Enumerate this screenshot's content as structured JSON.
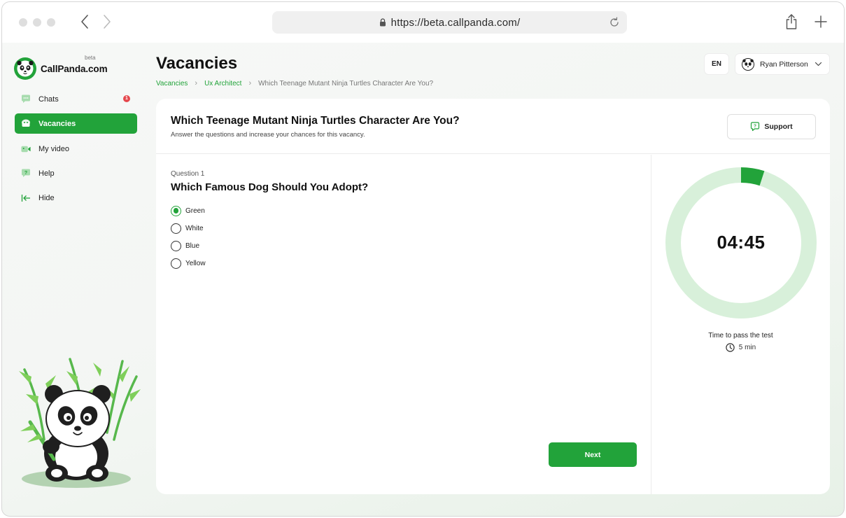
{
  "browser": {
    "url": "https://beta.callpanda.com/"
  },
  "brand": {
    "name": "CallPanda.com",
    "tag": "beta",
    "accent": "#22a33a"
  },
  "sidebar": {
    "items": [
      {
        "label": "Chats",
        "icon": "chat-icon",
        "badge": "1",
        "active": false
      },
      {
        "label": "Vacancies",
        "icon": "vacancies-icon",
        "active": true
      },
      {
        "label": "My video",
        "icon": "video-icon",
        "active": false
      },
      {
        "label": "Help",
        "icon": "help-icon",
        "active": false
      },
      {
        "label": "Hide",
        "icon": "collapse-icon",
        "active": false
      }
    ]
  },
  "header": {
    "title": "Vacancies",
    "breadcrumb": [
      "Vacancies",
      "Ux Architect",
      "Which Teenage Mutant Ninja Turtles Character Are You?"
    ],
    "language": "EN",
    "user_name": "Ryan Pitterson"
  },
  "test": {
    "title": "Which Teenage Mutant Ninja Turtles Character Are You?",
    "subtitle": "Answer the questions and increase your chances for this vacancy.",
    "support_label": "Support",
    "question_number": "Question 1",
    "question_text": "Which Famous Dog Should You Adopt?",
    "options": [
      {
        "label": "Green",
        "selected": true
      },
      {
        "label": "White",
        "selected": false
      },
      {
        "label": "Blue",
        "selected": false
      },
      {
        "label": "Yellow",
        "selected": false
      }
    ],
    "next_label": "Next"
  },
  "timer": {
    "remaining": "04:45",
    "elapsed_fraction": 0.05,
    "label": "Time to pass the test",
    "duration": "5 min",
    "ring_color": "#d8f0da",
    "progress_color": "#22a33a"
  }
}
